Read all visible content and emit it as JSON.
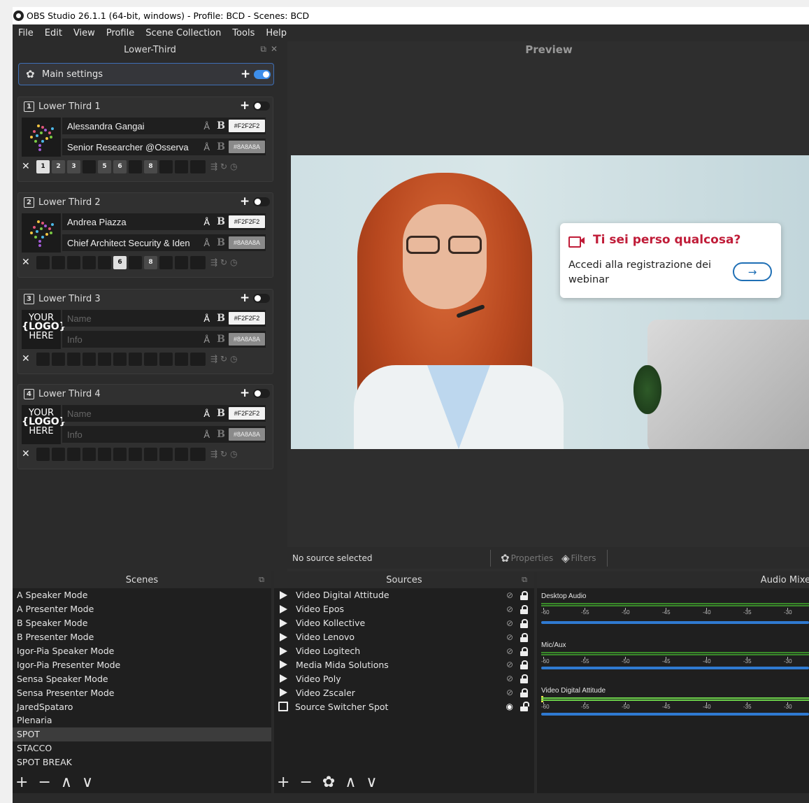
{
  "window": {
    "title": "OBS Studio 26.1.1 (64-bit, windows) - Profile: BCD - Scenes: BCD"
  },
  "menu": [
    "File",
    "Edit",
    "View",
    "Profile",
    "Scene Collection",
    "Tools",
    "Help"
  ],
  "lower_third_dock": {
    "title": "Lower-Third",
    "main_settings": {
      "label": "Main settings",
      "enabled": true
    },
    "entries": [
      {
        "num": "1",
        "label": "Lower Third 1",
        "enabled": false,
        "logo": "brain-image",
        "name": "Alessandra Gangai",
        "info": "Senior Researcher @Osserva",
        "name_color": "#F2F2F2",
        "info_color": "#8A8A8A",
        "slots": [
          "1",
          "2",
          "3",
          "",
          "5",
          "6",
          "",
          "8",
          "",
          ""
        ],
        "active_slot": "1"
      },
      {
        "num": "2",
        "label": "Lower Third 2",
        "enabled": false,
        "logo": "brain-image",
        "name": "Andrea Piazza",
        "info": "Chief Architect Security & Iden",
        "name_color": "#F2F2F2",
        "info_color": "#8A8A8A",
        "slots": [
          "",
          "",
          "",
          "",
          "",
          "6",
          "",
          "8",
          "",
          ""
        ],
        "active_slot": "6"
      },
      {
        "num": "3",
        "label": "Lower Third 3",
        "enabled": false,
        "logo_text": [
          "YOUR",
          "{LOGO}",
          "HERE"
        ],
        "name_placeholder": "Name",
        "info_placeholder": "Info",
        "name_color": "#F2F2F2",
        "info_color": "#8A8A8A"
      },
      {
        "num": "4",
        "label": "Lower Third 4",
        "enabled": false,
        "logo_text": [
          "YOUR",
          "{LOGO}",
          "HERE"
        ],
        "name_placeholder": "Name",
        "info_placeholder": "Info",
        "name_color": "#F2F2F2",
        "info_color": "#8A8A8A"
      }
    ]
  },
  "preview": {
    "title": "Preview",
    "callout": {
      "headline": "Ti sei perso qualcosa?",
      "body": "Accedi alla registrazione dei webinar",
      "arrow": "→"
    }
  },
  "status": {
    "text": "No source selected",
    "properties": "Properties",
    "filters": "Filters"
  },
  "scenes": {
    "title": "Scenes",
    "items": [
      "A Speaker Mode",
      "A Presenter Mode",
      "B Speaker Mode",
      "B Presenter Mode",
      "Igor-Pia Speaker Mode",
      "Igor-Pia Presenter Mode",
      "Sensa Speaker Mode",
      "Sensa Presenter Mode",
      "JaredSpataro",
      "Plenaria",
      "SPOT",
      "STACCO",
      "SPOT BREAK"
    ],
    "selected": "SPOT"
  },
  "sources": {
    "title": "Sources",
    "items": [
      {
        "name": "Video Digital Attitude",
        "type": "media",
        "visible": false,
        "locked": true
      },
      {
        "name": "Video Epos",
        "type": "media",
        "visible": false,
        "locked": true
      },
      {
        "name": "Video Kollective",
        "type": "media",
        "visible": false,
        "locked": true
      },
      {
        "name": "Video Lenovo",
        "type": "media",
        "visible": false,
        "locked": true
      },
      {
        "name": "Video Logitech",
        "type": "media",
        "visible": false,
        "locked": true
      },
      {
        "name": "Media Mida Solutions",
        "type": "media",
        "visible": false,
        "locked": true
      },
      {
        "name": "Video Poly",
        "type": "media",
        "visible": false,
        "locked": true
      },
      {
        "name": "Video Zscaler",
        "type": "media",
        "visible": false,
        "locked": true
      },
      {
        "name": "Source Switcher Spot",
        "type": "switcher",
        "visible": true,
        "locked": false
      }
    ]
  },
  "mixer": {
    "title": "Audio Mixe",
    "ticks": [
      "-60",
      "-55",
      "-50",
      "-45",
      "-40",
      "-35",
      "-30"
    ],
    "channels": [
      {
        "name": "Desktop Audio"
      },
      {
        "name": "Mic/Aux"
      },
      {
        "name": "Video Digital Attitude"
      }
    ]
  },
  "toolbar_glyphs": {
    "add": "+",
    "remove": "−",
    "up": "∧",
    "down": "∨",
    "gear": "✿"
  }
}
